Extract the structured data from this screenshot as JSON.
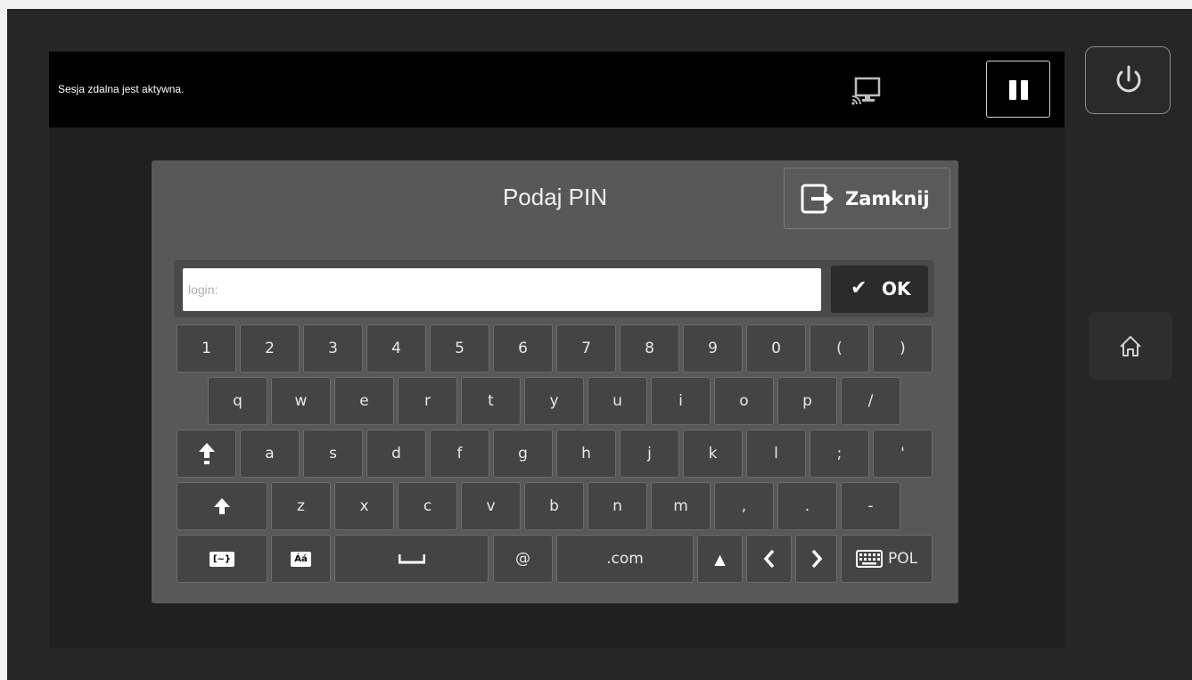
{
  "status_bar": {
    "message": "Sesja zdalna jest aktywna.",
    "remote_icon": "remote-screen-icon",
    "pause_icon": "pause-icon"
  },
  "side": {
    "power_icon": "power-icon",
    "home_icon": "home-icon"
  },
  "dialog": {
    "title": "Podaj PIN",
    "close_label": "Zamknij",
    "input_placeholder": "login:",
    "input_value": "",
    "ok_label": "OK"
  },
  "keyboard": {
    "row1": [
      "1",
      "2",
      "3",
      "4",
      "5",
      "6",
      "7",
      "8",
      "9",
      "0",
      "(",
      ")"
    ],
    "row2": [
      "q",
      "w",
      "e",
      "r",
      "t",
      "y",
      "u",
      "i",
      "o",
      "p",
      "/"
    ],
    "row3": [
      "a",
      "s",
      "d",
      "f",
      "g",
      "h",
      "j",
      "k",
      "l",
      ";",
      "'"
    ],
    "row4": [
      "z",
      "x",
      "c",
      "v",
      "b",
      "n",
      "m",
      ",",
      ".",
      "-"
    ],
    "row5": {
      "symbols": "[~}",
      "accents": "Áá",
      "at": "@",
      "dotcom": ".com",
      "language": "POL"
    }
  }
}
